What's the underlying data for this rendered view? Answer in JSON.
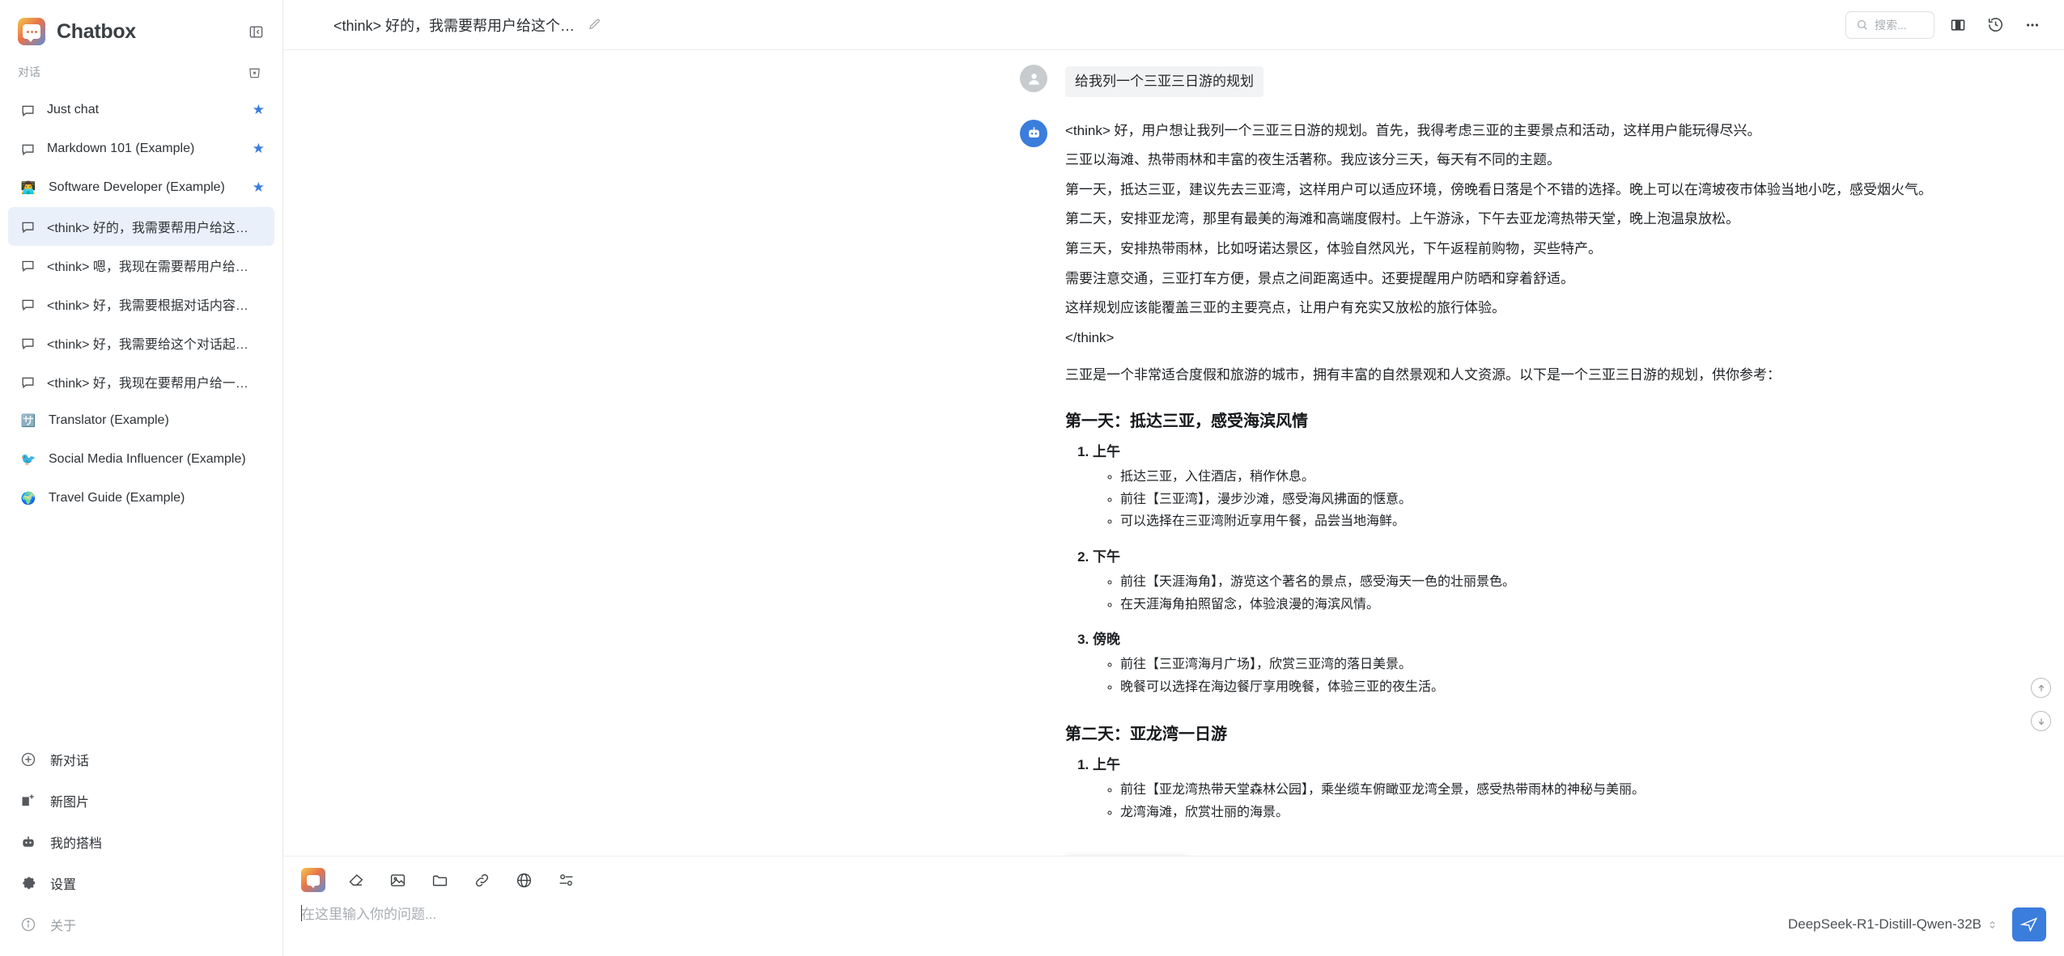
{
  "app": {
    "brand": "Chatbox",
    "brand_logo_icon": "chatbox-logo-icon",
    "collapse_icon": "collapse-panel-icon"
  },
  "sidebar": {
    "section_label": "对话",
    "clear_icon": "clear-conversations-icon",
    "conversations": [
      {
        "label": "Just chat",
        "icon": "chat-bubble-icon",
        "emoji": "",
        "starred": true,
        "active": false
      },
      {
        "label": "Markdown 101 (Example)",
        "icon": "chat-bubble-icon",
        "emoji": "",
        "starred": true,
        "active": false
      },
      {
        "label": "Software Developer (Example)",
        "icon": "avatar-emoji",
        "emoji": "👨‍💻",
        "starred": true,
        "active": false
      },
      {
        "label": "<think> 好的，我需要帮用户给这…",
        "icon": "chat-bubble-icon",
        "emoji": "",
        "starred": false,
        "active": true
      },
      {
        "label": "<think> 嗯，我现在需要帮用户给…",
        "icon": "chat-bubble-icon",
        "emoji": "",
        "starred": false,
        "active": false
      },
      {
        "label": "<think> 好，我需要根据对话内容…",
        "icon": "chat-bubble-icon",
        "emoji": "",
        "starred": false,
        "active": false
      },
      {
        "label": "<think> 好，我需要给这个对话起…",
        "icon": "chat-bubble-icon",
        "emoji": "",
        "starred": false,
        "active": false
      },
      {
        "label": "<think> 好，我现在要帮用户给一…",
        "icon": "chat-bubble-icon",
        "emoji": "",
        "starred": false,
        "active": false
      },
      {
        "label": "Translator (Example)",
        "icon": "avatar-emoji",
        "emoji": "🈂️",
        "starred": false,
        "active": false
      },
      {
        "label": "Social Media Influencer (Example)",
        "icon": "avatar-emoji",
        "emoji": "🐦",
        "starred": false,
        "active": false
      },
      {
        "label": "Travel Guide (Example)",
        "icon": "avatar-emoji",
        "emoji": "🌍",
        "starred": false,
        "active": false
      }
    ],
    "footer": [
      {
        "label": "新对话",
        "icon": "plus-circle-icon",
        "muted": false
      },
      {
        "label": "新图片",
        "icon": "new-image-icon",
        "muted": false
      },
      {
        "label": "我的搭档",
        "icon": "robot-icon",
        "muted": false
      },
      {
        "label": "设置",
        "icon": "gear-icon",
        "muted": false
      },
      {
        "label": "关于",
        "icon": "info-circle-icon",
        "muted": true
      }
    ]
  },
  "topbar": {
    "title": "<think> 好的，我需要帮用户给这个…",
    "edit_icon": "pencil-icon",
    "search_placeholder": "搜索...",
    "search_value": "",
    "search_icon": "search-icon",
    "split_view_icon": "split-view-icon",
    "history_icon": "history-clock-icon",
    "more_icon": "more-horizontal-icon"
  },
  "conversation": {
    "user_message": "给我列一个三亚三日游的规划",
    "user_avatar_icon": "user-avatar-icon",
    "bot_avatar_icon": "robot-avatar-icon",
    "think": {
      "open_tag": "<think>",
      "close_tag": "</think>",
      "paragraphs": [
        "<think> 好，用户想让我列一个三亚三日游的规划。首先，我得考虑三亚的主要景点和活动，这样用户能玩得尽兴。",
        "三亚以海滩、热带雨林和丰富的夜生活著称。我应该分三天，每天有不同的主题。",
        "第一天，抵达三亚，建议先去三亚湾，这样用户可以适应环境，傍晚看日落是个不错的选择。晚上可以在湾坡夜市体验当地小吃，感受烟火气。",
        "第二天，安排亚龙湾，那里有最美的海滩和高端度假村。上午游泳，下午去亚龙湾热带天堂，晚上泡温泉放松。",
        "第三天，安排热带雨林，比如呀诺达景区，体验自然风光，下午返程前购物，买些特产。",
        "需要注意交通，三亚打车方便，景点之间距离适中。还要提醒用户防晒和穿着舒适。",
        "这样规划应该能覆盖三亚的主要亮点，让用户有充实又放松的旅行体验。",
        "</think>"
      ]
    },
    "intro": "三亚是一个非常适合度假和旅游的城市，拥有丰富的自然景观和人文资源。以下是一个三亚三日游的规划，供你参考：",
    "days": [
      {
        "heading": "第一天：抵达三亚，感受海滨风情",
        "sections": [
          {
            "title": "上午",
            "items": [
              "抵达三亚，入住酒店，稍作休息。",
              "前往【三亚湾】，漫步沙滩，感受海风拂面的惬意。",
              "可以选择在三亚湾附近享用午餐，品尝当地海鲜。"
            ]
          },
          {
            "title": "下午",
            "items": [
              "前往【天涯海角】，游览这个著名的景点，感受海天一色的壮丽景色。",
              "在天涯海角拍照留念，体验浪漫的海滨风情。"
            ]
          },
          {
            "title": "傍晚",
            "items": [
              "前往【三亚湾海月广场】，欣赏三亚湾的落日美景。",
              "晚餐可以选择在海边餐厅享用晚餐，体验三亚的夜生活。"
            ]
          }
        ]
      },
      {
        "heading": "第二天：亚龙湾一日游",
        "sections": [
          {
            "title": "上午",
            "items": [
              "前往【亚龙湾热带天堂森林公园】，乘坐缆车俯瞰亚龙湾全景，感受热带雨林的神秘与美丽。",
              "龙湾海滩，欣赏壮丽的海景。"
            ]
          }
        ]
      }
    ]
  },
  "message_toolbar": {
    "stop_icon": "stop-square-icon",
    "edit_icon": "pencil-icon",
    "copy_icon": "copy-icon",
    "more_icon": "more-vertical-icon"
  },
  "scroll_controls": {
    "up_icon": "scroll-up-icon",
    "down_icon": "scroll-down-icon"
  },
  "composer": {
    "tools": [
      {
        "icon": "chatbox-app-icon",
        "name": "assistant-app-button"
      },
      {
        "icon": "eraser-icon",
        "name": "clear-context-button"
      },
      {
        "icon": "image-icon",
        "name": "attach-image-button"
      },
      {
        "icon": "folder-icon",
        "name": "attach-file-button"
      },
      {
        "icon": "link-icon",
        "name": "attach-link-button"
      },
      {
        "icon": "globe-icon",
        "name": "web-browsing-button"
      },
      {
        "icon": "sliders-icon",
        "name": "settings-sliders-button"
      }
    ],
    "placeholder": "在这里输入你的问题...",
    "value": "",
    "model": "DeepSeek-R1-Distill-Qwen-32B",
    "model_chevron_icon": "chevron-updown-icon",
    "send_icon": "send-icon"
  },
  "colors": {
    "accent_blue": "#3b7ddd",
    "active_item_bg": "#eaf0fa",
    "star_blue": "#3b7ddd",
    "stop_orange": "#e8732a",
    "user_bubble_bg": "#f2f3f4"
  }
}
